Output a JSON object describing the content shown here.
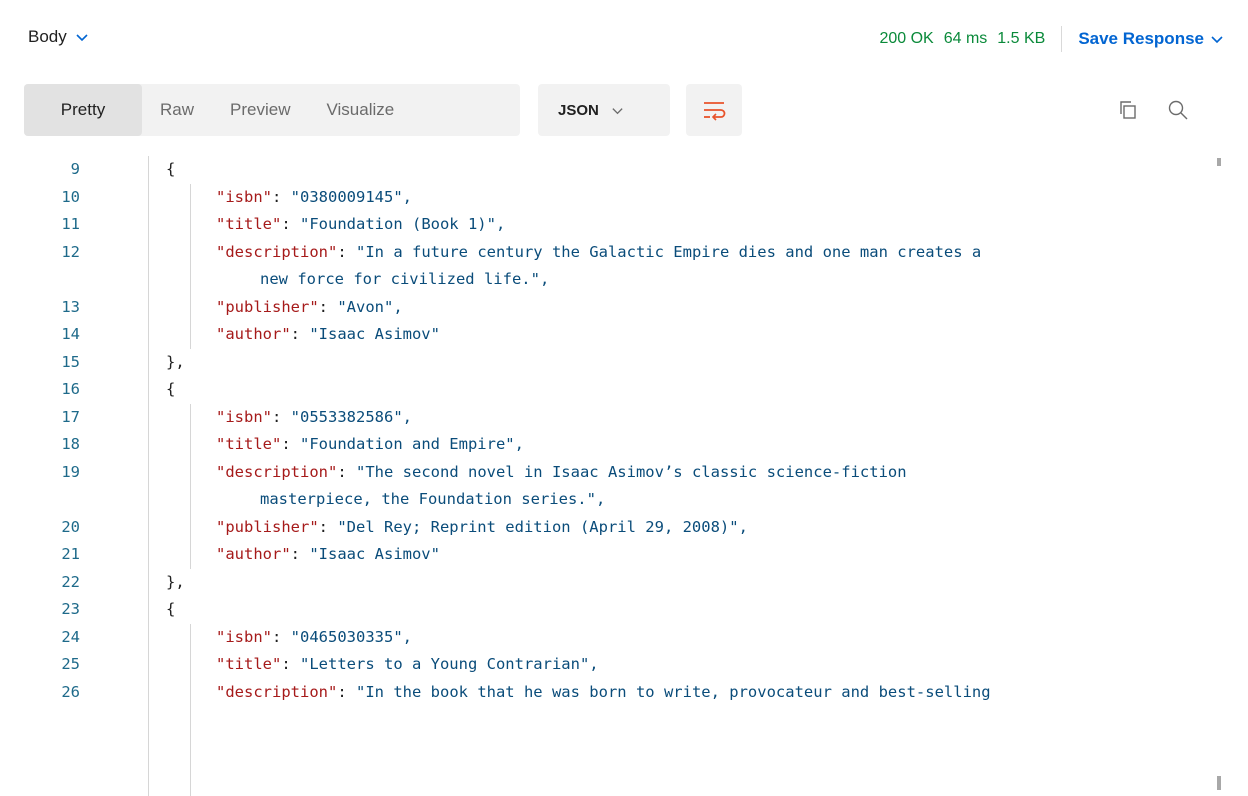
{
  "header": {
    "body_label": "Body",
    "status": "200 OK",
    "time": "64 ms",
    "size": "1.5 KB",
    "save_response_label": "Save Response"
  },
  "toolbar": {
    "tabs": [
      "Pretty",
      "Raw",
      "Preview",
      "Visualize"
    ],
    "active_tab": "Pretty",
    "format": "JSON",
    "icons": [
      "chevron-down-icon",
      "wrap-lines-icon",
      "copy-icon",
      "search-icon"
    ]
  },
  "colors": {
    "status_green": "#0a8a3a",
    "accent_blue": "#0265d2",
    "json_key": "#a61a1a",
    "json_string": "#0a4c7a",
    "line_number": "#1e6a8a"
  },
  "code": {
    "lines": [
      {
        "n": "9",
        "kind": "open",
        "text": "{"
      },
      {
        "n": "10",
        "kind": "kv",
        "key": "\"isbn\"",
        "value": "\"0380009145\","
      },
      {
        "n": "11",
        "kind": "kv",
        "key": "\"title\"",
        "value": "\"Foundation (Book 1)\","
      },
      {
        "n": "12",
        "kind": "kv",
        "key": "\"description\"",
        "value": "\"In a future century the Galactic Empire dies and one man creates a"
      },
      {
        "n": "",
        "kind": "cont",
        "value": "new force for civilized life.\","
      },
      {
        "n": "13",
        "kind": "kv",
        "key": "\"publisher\"",
        "value": "\"Avon\","
      },
      {
        "n": "14",
        "kind": "kv",
        "key": "\"author\"",
        "value": "\"Isaac Asimov\""
      },
      {
        "n": "15",
        "kind": "close",
        "text": "},"
      },
      {
        "n": "16",
        "kind": "open",
        "text": "{"
      },
      {
        "n": "17",
        "kind": "kv",
        "key": "\"isbn\"",
        "value": "\"0553382586\","
      },
      {
        "n": "18",
        "kind": "kv",
        "key": "\"title\"",
        "value": "\"Foundation and Empire\","
      },
      {
        "n": "19",
        "kind": "kv",
        "key": "\"description\"",
        "value": "\"The second novel in Isaac Asimov’s classic science-fiction"
      },
      {
        "n": "",
        "kind": "cont",
        "value": "masterpiece, the Foundation series.\","
      },
      {
        "n": "20",
        "kind": "kv",
        "key": "\"publisher\"",
        "value": "\"Del Rey; Reprint edition (April 29, 2008)\","
      },
      {
        "n": "21",
        "kind": "kv",
        "key": "\"author\"",
        "value": "\"Isaac Asimov\""
      },
      {
        "n": "22",
        "kind": "close",
        "text": "},"
      },
      {
        "n": "23",
        "kind": "open",
        "text": "{"
      },
      {
        "n": "24",
        "kind": "kv",
        "key": "\"isbn\"",
        "value": "\"0465030335\","
      },
      {
        "n": "25",
        "kind": "kv",
        "key": "\"title\"",
        "value": "\"Letters to a Young Contrarian\","
      },
      {
        "n": "26",
        "kind": "kv",
        "key": "\"description\"",
        "value": "\"In the book that he was born to write, provocateur and best-selling"
      }
    ]
  }
}
